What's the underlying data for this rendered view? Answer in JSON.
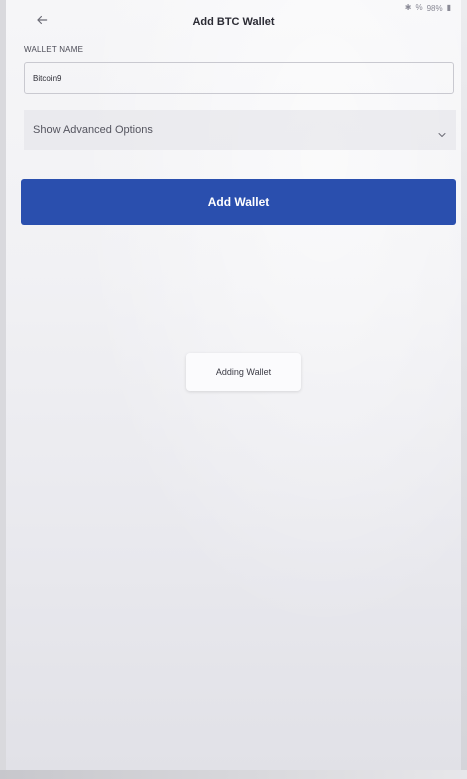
{
  "status_bar": {
    "battery_text": "98%"
  },
  "header": {
    "title": "Add BTC Wallet"
  },
  "form": {
    "wallet_name_label": "WALLET NAME",
    "wallet_name_value": "Bitcoin9",
    "advanced_options_label": "Show Advanced Options"
  },
  "actions": {
    "add_wallet_label": "Add Wallet"
  },
  "toast": {
    "message": "Adding Wallet"
  },
  "icons": {
    "back": "arrow-left-icon",
    "chevron": "chevron-down-icon",
    "bluetooth": "bluetooth-icon",
    "battery": "battery-icon"
  },
  "colors": {
    "primary": "#2a4fae",
    "text": "#2c2c35"
  }
}
